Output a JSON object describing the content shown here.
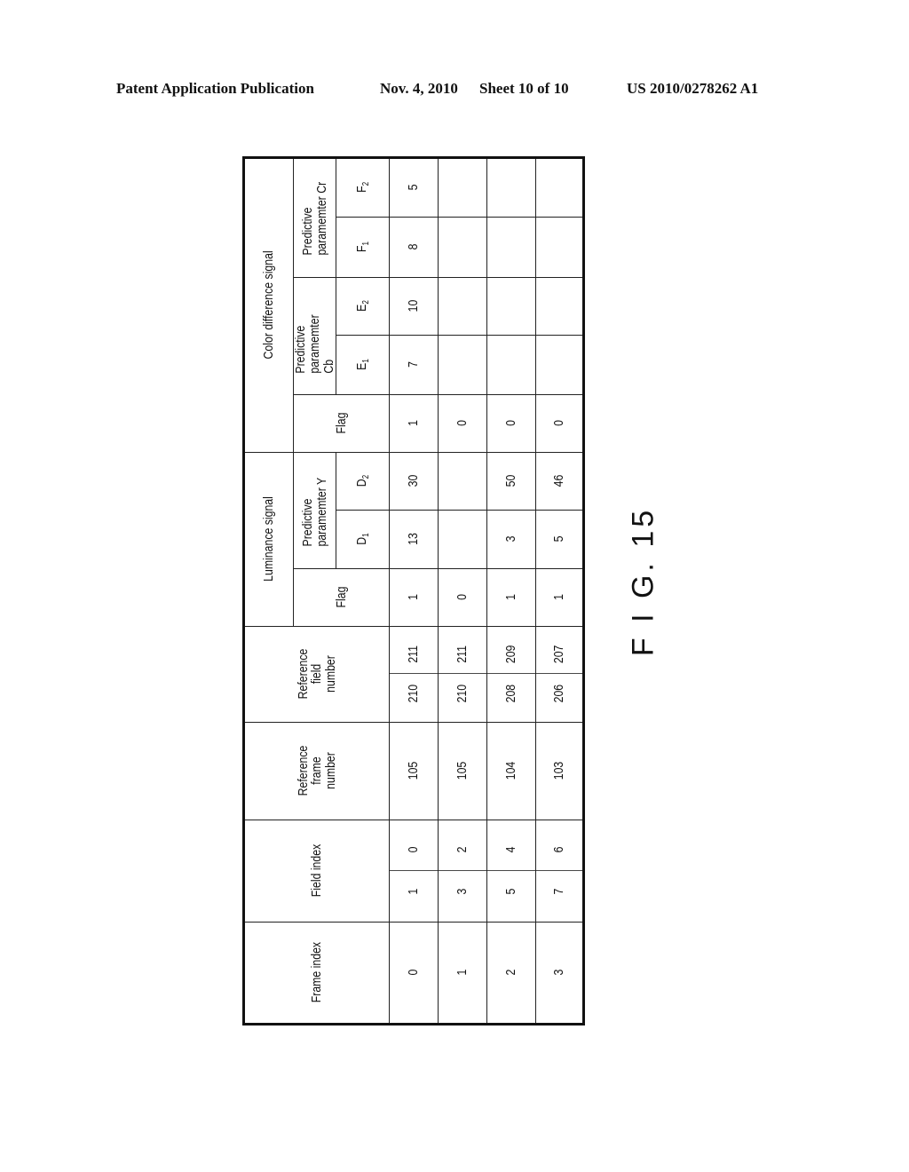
{
  "header": {
    "publication": "Patent Application Publication",
    "date": "Nov. 4, 2010",
    "sheet": "Sheet 10 of 10",
    "number": "US 2010/0278262 A1"
  },
  "figure_label": "F I G. 15",
  "table": {
    "col_headers": {
      "frame_index": "Frame index",
      "field_index": "Field index",
      "ref_frame": "Reference frame number",
      "ref_field": "Reference field number",
      "luminance": "Luminance signal",
      "color_diff": "Color difference signal",
      "flag": "Flag",
      "pred_y": "Predictive paramemter Y",
      "pred_cb": "Predictive paramemter Cb",
      "pred_cr": "Predictive paramemter Cr",
      "d1": "D",
      "d2": "D",
      "e1": "E",
      "e2": "E",
      "f1": "F",
      "f2": "F",
      "sub1": "1",
      "sub2": "2"
    },
    "rows": [
      {
        "frame_index": "0",
        "field_index": [
          "1",
          "0"
        ],
        "ref_frame": "105",
        "ref_field": [
          "210",
          "211"
        ],
        "lum_flag": "1",
        "d1": "13",
        "d2": "30",
        "col_flag": "1",
        "e1": "7",
        "e2": "10",
        "f1": "8",
        "f2": "5"
      },
      {
        "frame_index": "1",
        "field_index": [
          "3",
          "2"
        ],
        "ref_frame": "105",
        "ref_field": [
          "210",
          "211"
        ],
        "lum_flag": "0",
        "d1": "",
        "d2": "",
        "col_flag": "0",
        "e1": "",
        "e2": "",
        "f1": "",
        "f2": ""
      },
      {
        "frame_index": "2",
        "field_index": [
          "5",
          "4"
        ],
        "ref_frame": "104",
        "ref_field": [
          "208",
          "209"
        ],
        "lum_flag": "1",
        "d1": "3",
        "d2": "50",
        "col_flag": "0",
        "e1": "",
        "e2": "",
        "f1": "",
        "f2": ""
      },
      {
        "frame_index": "3",
        "field_index": [
          "7",
          "6"
        ],
        "ref_frame": "103",
        "ref_field": [
          "206",
          "207"
        ],
        "lum_flag": "1",
        "d1": "5",
        "d2": "46",
        "col_flag": "0",
        "e1": "",
        "e2": "",
        "f1": "",
        "f2": ""
      }
    ]
  }
}
